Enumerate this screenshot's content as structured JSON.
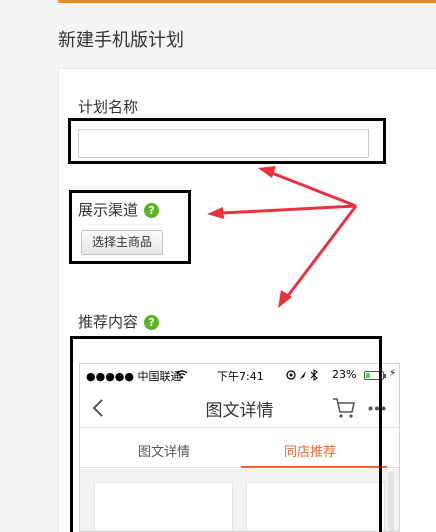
{
  "page": {
    "title": "新建手机版计划"
  },
  "form": {
    "plan_name_label": "计划名称",
    "plan_name_value": "",
    "channel_label": "展示渠道",
    "select_product_label": "选择主商品",
    "recommend_label": "推荐内容",
    "help_glyph": "?"
  },
  "phone": {
    "status": {
      "carrier": "●●●●● 中国联通",
      "time": "下午7:41",
      "battery": "23%",
      "battery_level": 0.23
    },
    "nav_title": "图文详情",
    "tabs": [
      {
        "label": "图文详情",
        "active": false
      },
      {
        "label": "同店推荐",
        "active": true
      }
    ]
  },
  "colors": {
    "accent": "#f08c1e",
    "tab_active": "#f06428",
    "help_green": "#5ab41e",
    "arrow_red": "#e8333c"
  }
}
